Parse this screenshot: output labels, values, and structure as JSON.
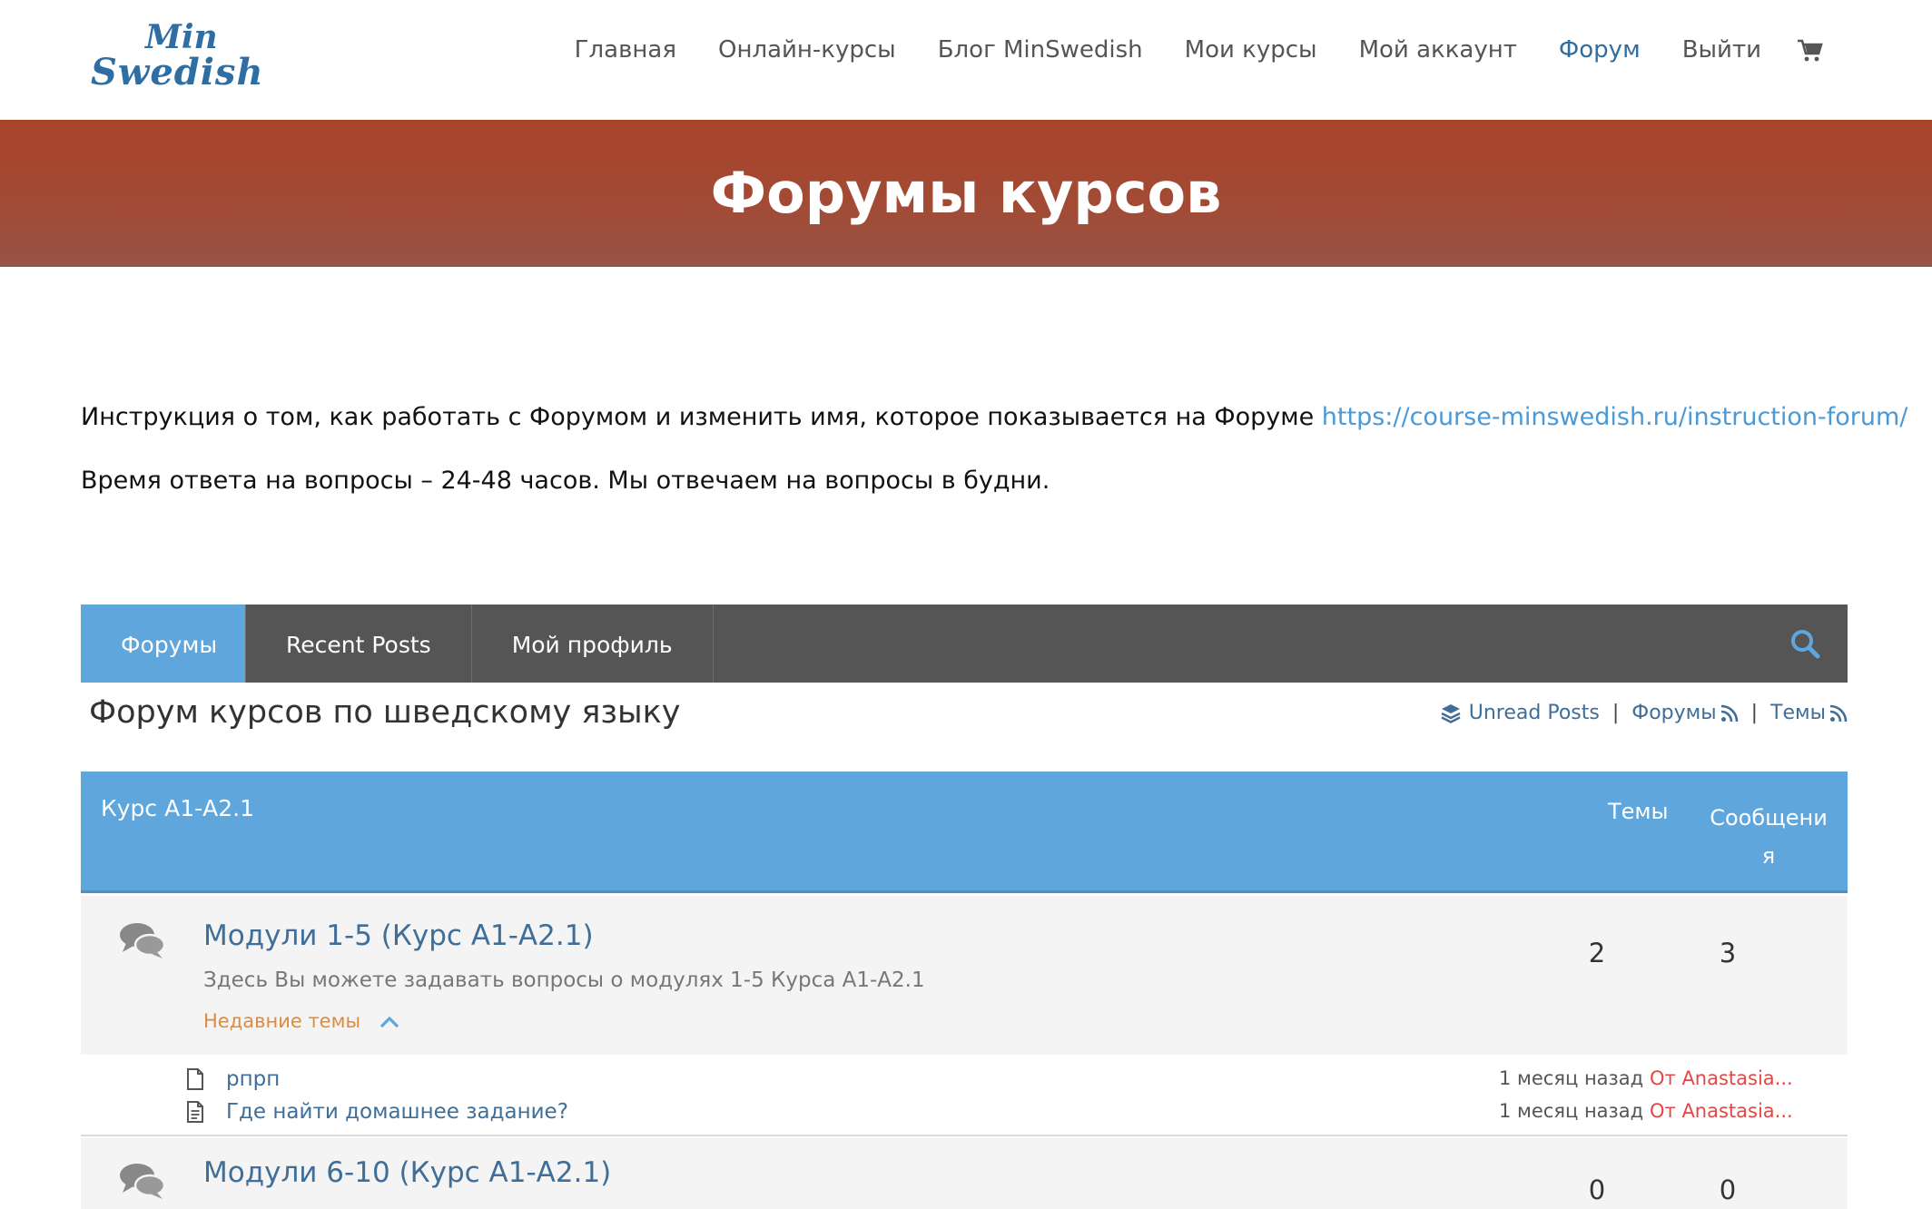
{
  "header": {
    "logo_line1": "Min",
    "logo_line2": "Swedish",
    "nav": [
      "Главная",
      "Онлайн-курсы",
      "Блог MinSwedish",
      "Мои курсы",
      "Мой аккаунт",
      "Форум",
      "Выйти"
    ],
    "active_nav": "Форум",
    "cart_icon": "cart-icon"
  },
  "banner": {
    "title": "Форумы курсов"
  },
  "info": {
    "instruction_text": "Инструкция о том, как работать с Форумом и изменить имя, которое показывается на Форуме ",
    "instruction_link": "https://course-minswedish.ru/instruction-forum/",
    "response_time": "Время ответа на вопросы – 24-48 часов. Мы отвечаем на вопросы в будни."
  },
  "tabs": {
    "items": [
      "Форумы",
      "Recent Posts",
      "Мой профиль"
    ],
    "active": "Форумы",
    "search_icon": "search-icon"
  },
  "forum": {
    "title": "Форум курсов по шведскому языку",
    "unread_posts": "Unread Posts",
    "feed_forums": "Форумы",
    "feed_topics": "Темы",
    "separator": "|"
  },
  "course": {
    "name": "Курс А1-А2.1",
    "col_topics": "Темы",
    "col_posts_line1": "Сообщени",
    "col_posts_line2": "я"
  },
  "forums": [
    {
      "title": "Модули 1-5 (Курс А1-А2.1)",
      "description": "Здесь Вы можете задавать вопросы о модулях 1-5 Курса А1-А2.1",
      "recent_label": "Недавние темы",
      "topics_count": "2",
      "posts_count": "3"
    },
    {
      "title": "Модули 6-10 (Курс А1-А2.1)",
      "topics_count": "0",
      "posts_count": "0"
    }
  ],
  "recent_topics": [
    {
      "name": "рпрп",
      "time": "1 месяц назад",
      "by": "От Anastasia..."
    },
    {
      "name": "Где найти домашнее задание?",
      "time": "1 месяц назад",
      "by": "От Anastasia..."
    }
  ]
}
